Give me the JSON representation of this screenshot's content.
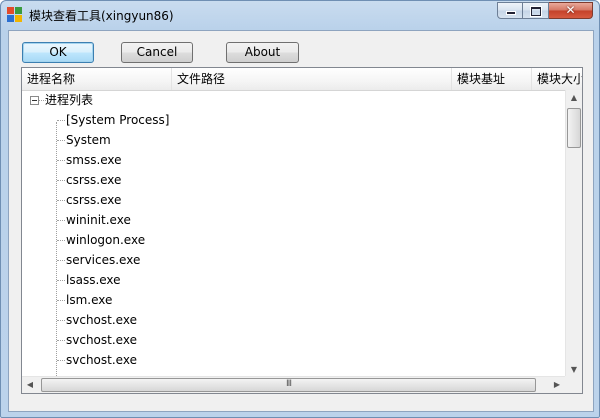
{
  "window": {
    "title": "模块查看工具(xingyun86)",
    "minimize_icon": "minimize-icon",
    "maximize_icon": "maximize-icon",
    "close_icon": "close-icon",
    "close_glyph": "✕"
  },
  "toolbar": {
    "ok_label": "OK",
    "cancel_label": "Cancel",
    "about_label": "About"
  },
  "columns": [
    "进程名称",
    "文件路径",
    "模块基址",
    "模块大小"
  ],
  "tree": {
    "root_label": "进程列表",
    "children": [
      "[System Process]",
      "System",
      "smss.exe",
      "csrss.exe",
      "csrss.exe",
      "wininit.exe",
      "winlogon.exe",
      "services.exe",
      "lsass.exe",
      "lsm.exe",
      "svchost.exe",
      "svchost.exe",
      "svchost.exe"
    ]
  },
  "scrollbars": {
    "up_arrow": "▲",
    "down_arrow": "▼",
    "left_arrow": "◀",
    "right_arrow": "▶",
    "grip": "III"
  },
  "colors": {
    "title_bar": "#b9d1ea",
    "default_button": "#bee6fd",
    "close_button": "#c4412a"
  }
}
